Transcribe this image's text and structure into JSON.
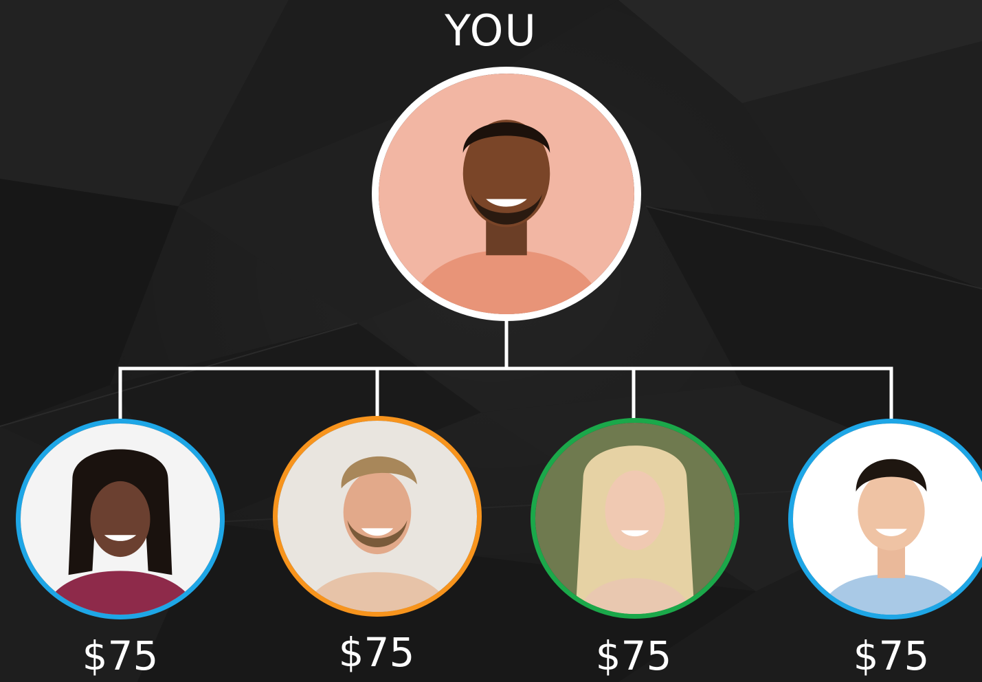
{
  "title": "YOU",
  "colors": {
    "background": "#1c1c1c",
    "connector": "#ffffff",
    "root_border": "#ffffff",
    "blue": "#1ea6e6",
    "orange": "#f7941d",
    "green": "#1ba84a"
  },
  "root": {
    "icon": "person-photo-icon"
  },
  "children": [
    {
      "amount": "$75",
      "border_color": "#1ea6e6",
      "icon": "person-photo-icon"
    },
    {
      "amount": "$75",
      "border_color": "#f7941d",
      "icon": "person-photo-icon"
    },
    {
      "amount": "$75",
      "border_color": "#1ba84a",
      "icon": "person-photo-icon"
    },
    {
      "amount": "$75",
      "border_color": "#1ea6e6",
      "icon": "person-photo-icon"
    }
  ]
}
